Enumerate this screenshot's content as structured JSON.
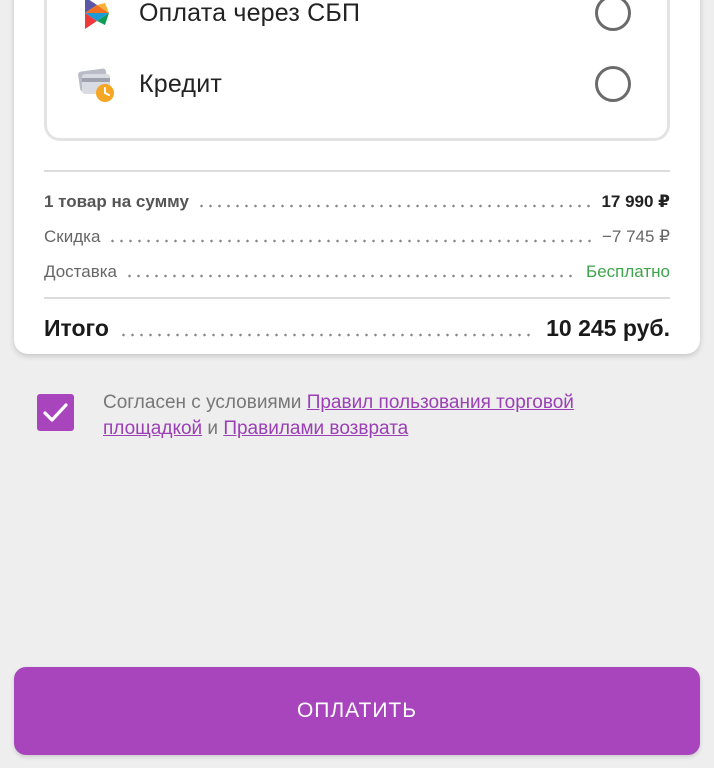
{
  "payment_methods": [
    {
      "label": "Оплата через СБП",
      "icon": "sbp-icon",
      "selected": false
    },
    {
      "label": "Кредит",
      "icon": "credit-card-clock-icon",
      "selected": false
    }
  ],
  "summary": {
    "items_label": "1 товар на сумму",
    "items_value": "17 990 ₽",
    "discount_label": "Скидка",
    "discount_value": "−7 745 ₽",
    "delivery_label": "Доставка",
    "delivery_value": "Бесплатно",
    "total_label": "Итого",
    "total_value": "10 245 руб."
  },
  "agreement": {
    "checked": true,
    "text_prefix": "Согласен с условиями ",
    "link1": "Правил пользования торговой площадкой",
    "text_mid": " и ",
    "link2": "Правилами возврата"
  },
  "pay_button": {
    "label": "ОПЛАТИТЬ"
  },
  "colors": {
    "accent": "#a845bd",
    "free_green": "#3fa34d",
    "background": "#eeeeee"
  }
}
